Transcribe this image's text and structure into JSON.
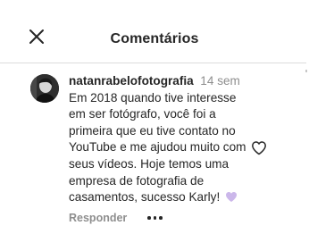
{
  "header": {
    "title": "Comentários",
    "close_icon": "close-icon"
  },
  "comment": {
    "username": "natanrabelofotografia",
    "timestamp": "14 sem",
    "text": "Em 2018 quando tive interesse em ser fotógrafo, você foi a primeira que eu tive contato no YouTube e me ajudou muito com seus vídeos. Hoje temos uma empresa de fotografia de casamentos, sucesso Karly!",
    "emoji_icon": "purple-heart-icon",
    "like_icon": "heart-outline-icon",
    "reply_label": "Responder",
    "more_icon": "more-options-icon"
  },
  "colors": {
    "text": "#262626",
    "secondary": "#8e8e8e",
    "divider": "#dbdbdb",
    "purple_heart": "#c9b6e8"
  }
}
